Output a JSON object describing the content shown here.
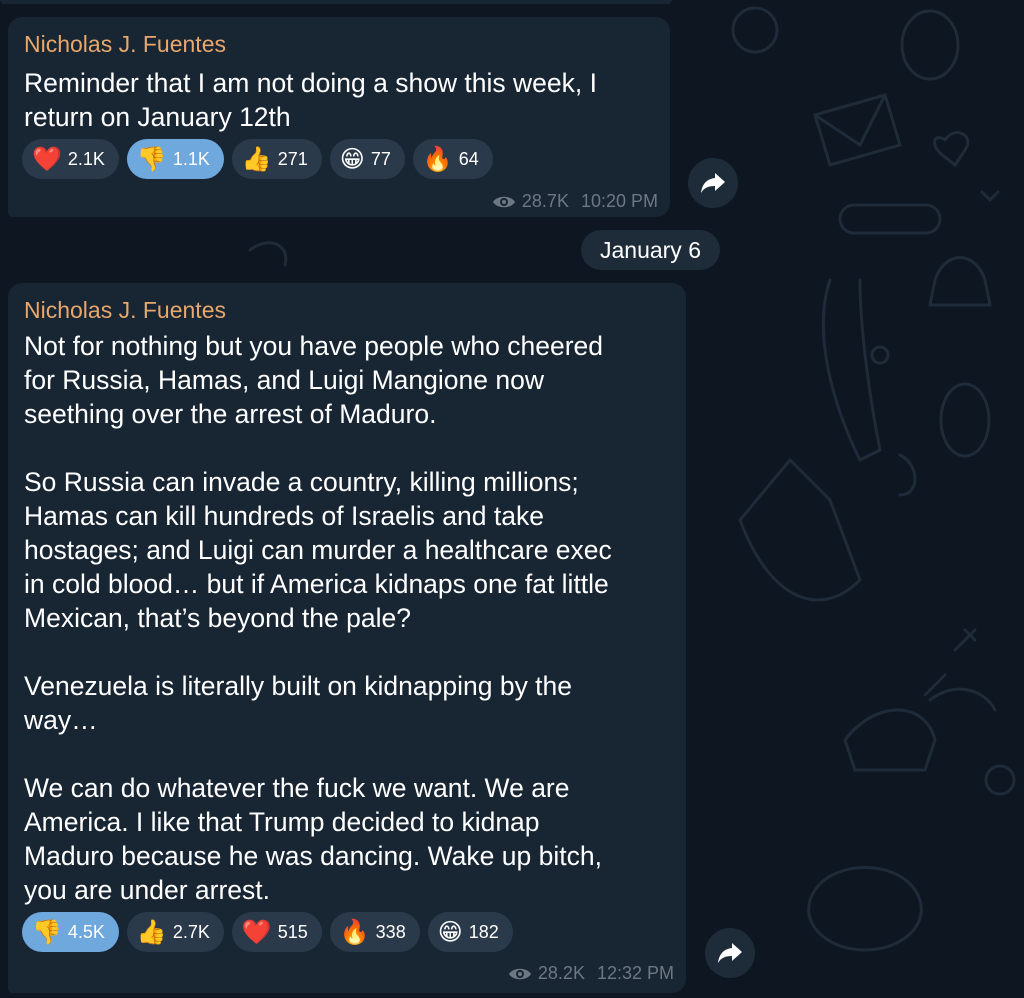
{
  "date_separator": "January 6",
  "messages": [
    {
      "sender": "Nicholas J. Fuentes",
      "text": "Reminder that I am not doing a show this week, I\nreturn on January 12th",
      "reactions": [
        {
          "emoji": "❤️",
          "count": "2.1K",
          "chosen": false
        },
        {
          "emoji": "👎",
          "count": "1.1K",
          "chosen": true
        },
        {
          "emoji": "👍",
          "count": "271",
          "chosen": false
        },
        {
          "emoji": "😁",
          "count": "77",
          "chosen": false
        },
        {
          "emoji": "🔥",
          "count": "64",
          "chosen": false
        }
      ],
      "views": "28.7K",
      "time": "10:20 PM"
    },
    {
      "sender": "Nicholas J. Fuentes",
      "text": "Not for nothing but you have people who cheered\nfor Russia, Hamas, and Luigi Mangione now\nseething over the arrest of Maduro.\n\nSo Russia can invade a country, killing millions;\nHamas can kill hundreds of Israelis and take\nhostages; and Luigi can murder a healthcare exec\nin cold blood… but if America kidnaps one fat little\nMexican, that’s beyond the pale?\n\nVenezuela is literally built on kidnapping by the\nway…\n\nWe can do whatever the fuck we want. We are\nAmerica. I like that Trump decided to kidnap\nMaduro because he was dancing. Wake up bitch,\nyou are under arrest.",
      "reactions": [
        {
          "emoji": "👎",
          "count": "4.5K",
          "chosen": true
        },
        {
          "emoji": "👍",
          "count": "2.7K",
          "chosen": false
        },
        {
          "emoji": "❤️",
          "count": "515",
          "chosen": false
        },
        {
          "emoji": "🔥",
          "count": "338",
          "chosen": false
        },
        {
          "emoji": "😁",
          "count": "182",
          "chosen": false
        }
      ],
      "views": "28.2K",
      "time": "12:32 PM"
    }
  ],
  "icons": {
    "views": "eye-icon",
    "forward": "forward-arrow-icon"
  },
  "colors": {
    "background": "#0e1621",
    "bubble": "#182533",
    "sender_name": "#e8a76b",
    "reaction_chosen": "#6ea8dd",
    "reaction_default": "#2b3a4a",
    "meta_text": "#6c7883"
  }
}
